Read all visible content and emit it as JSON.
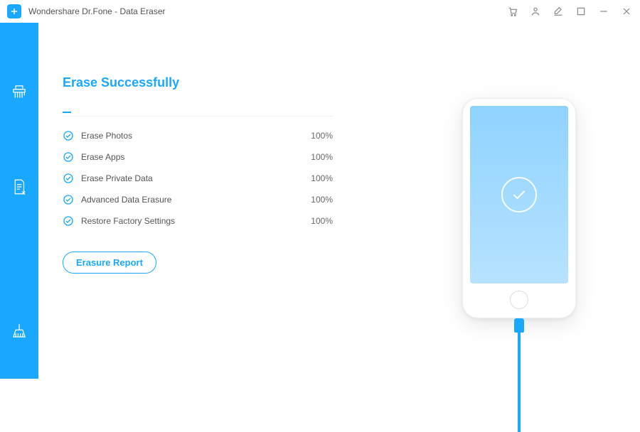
{
  "titlebar": {
    "title": "Wondershare Dr.Fone - Data Eraser"
  },
  "main": {
    "heading": "Erase Successfully",
    "tasks": [
      {
        "label": "Erase Photos",
        "percent": "100%"
      },
      {
        "label": "Erase Apps",
        "percent": "100%"
      },
      {
        "label": "Erase Private Data",
        "percent": "100%"
      },
      {
        "label": "Advanced Data Erasure",
        "percent": "100%"
      },
      {
        "label": "Restore Factory Settings",
        "percent": "100%"
      }
    ],
    "report_button": "Erasure Report"
  },
  "colors": {
    "accent": "#1aa8ff"
  }
}
